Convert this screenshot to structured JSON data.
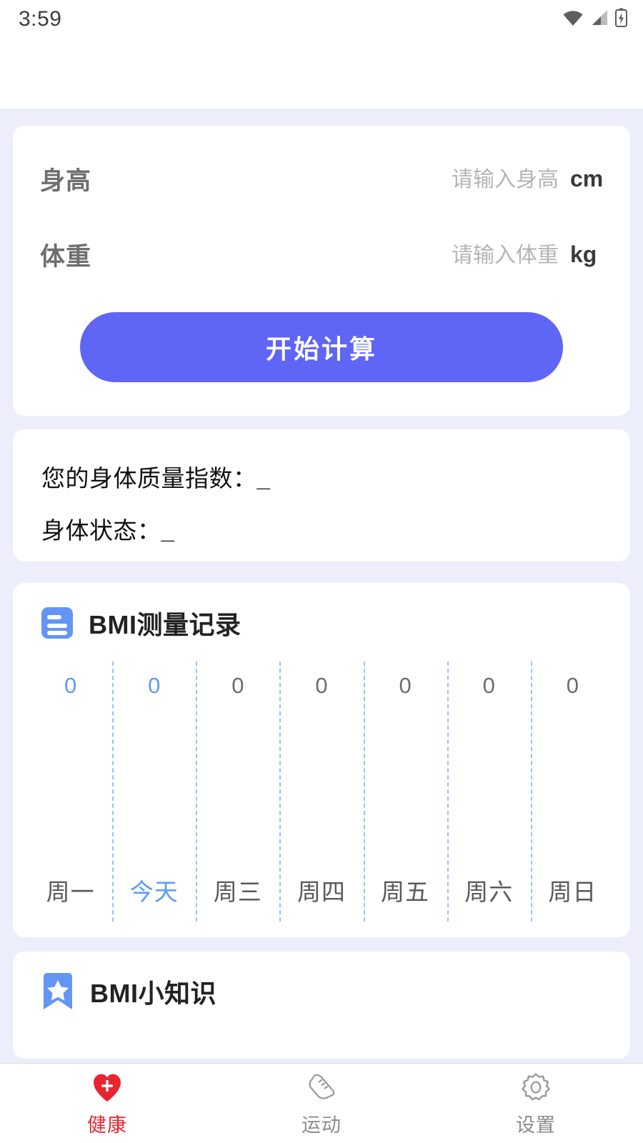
{
  "statusbar": {
    "time": "3:59",
    "icons": [
      "wifi-icon",
      "cellular-signal-icon",
      "battery-charging-icon"
    ]
  },
  "theme": {
    "page_background": "#ECEEFB",
    "card_background": "#FFFFFF",
    "primary_button": "#5F65F5",
    "accent_blue": "#5B9BF8",
    "icon_blue": "#6495F5",
    "active_tab_red": "#E8252F",
    "label_gray": "#6E6E6E",
    "placeholder_gray": "#B5B5B5",
    "gridline_blue": "#9CC2F5"
  },
  "input_card": {
    "height": {
      "label": "身高",
      "placeholder": "请输入身高",
      "value": "",
      "unit": "cm"
    },
    "weight": {
      "label": "体重",
      "placeholder": "请输入体重",
      "value": "",
      "unit": "kg"
    },
    "submit_label": "开始计算"
  },
  "result_card": {
    "bmi_label": "您的身体质量指数：",
    "bmi_value": "_",
    "state_label": "身体状态：",
    "state_value": "_"
  },
  "chart_card": {
    "icon": "list-icon",
    "title": "BMI测量记录"
  },
  "tips_card": {
    "icon": "bookmark-star-icon",
    "title": "BMI小知识"
  },
  "tabbar": {
    "items": [
      {
        "label": "健康",
        "icon": "heart-plus-icon",
        "active": true
      },
      {
        "label": "运动",
        "icon": "shoe-icon",
        "active": false
      },
      {
        "label": "设置",
        "icon": "gear-icon",
        "active": false
      }
    ]
  },
  "chart_data": {
    "type": "line",
    "title": "BMI测量记录",
    "categories": [
      "周一",
      "今天",
      "周三",
      "周四",
      "周五",
      "周六",
      "周日"
    ],
    "values": [
      0,
      0,
      0,
      0,
      0,
      0,
      0
    ],
    "value_labels": [
      "0",
      "0",
      "0",
      "0",
      "0",
      "0",
      "0"
    ],
    "highlighted_indices": [
      0,
      1
    ],
    "highlighted_category_index": 1,
    "xlabel": "",
    "ylabel": "",
    "ylim": [
      0,
      0
    ],
    "grid": true,
    "grid_style": "dashed-vertical",
    "legend": "none"
  }
}
